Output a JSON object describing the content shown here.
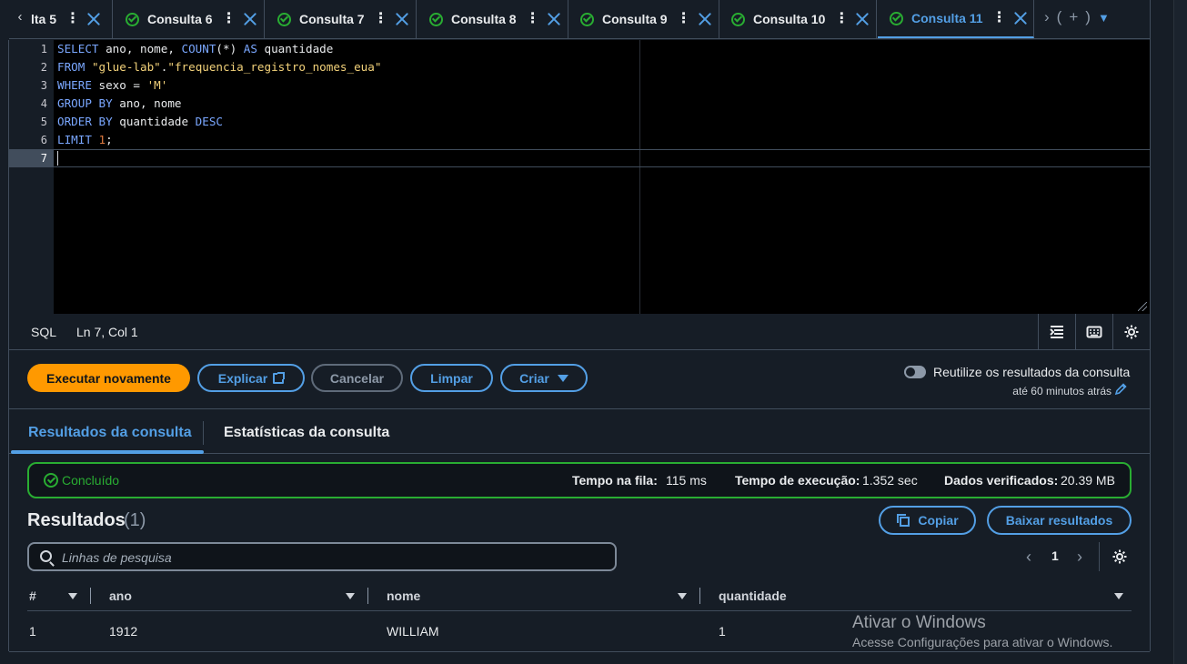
{
  "tabs": [
    {
      "label": "lta 5",
      "active": false
    },
    {
      "label": "Consulta 6",
      "active": false
    },
    {
      "label": "Consulta 7",
      "active": false
    },
    {
      "label": "Consulta 8",
      "active": false
    },
    {
      "label": "Consulta 9",
      "active": false
    },
    {
      "label": "Consulta 10",
      "active": false
    },
    {
      "label": "Consulta 11",
      "active": true
    }
  ],
  "tab_tools": {
    "prev": "›",
    "open_paren": "(",
    "plus": "+",
    "close_paren": ")",
    "dropdown": "▼"
  },
  "editor": {
    "line_numbers": [
      "1",
      "2",
      "3",
      "4",
      "5",
      "6",
      "7"
    ],
    "current_line": "7"
  },
  "statusbar": {
    "language": "SQL",
    "position": "Ln 7, Col 1"
  },
  "actions": {
    "run_again": "Executar novamente",
    "explain": "Explicar",
    "cancel": "Cancelar",
    "clear": "Limpar",
    "create": "Criar",
    "reuse_label": "Reutilize os resultados da consulta",
    "reuse_sub": "até 60 minutos atrás"
  },
  "results_tabs": {
    "results": "Resultados da consulta",
    "stats": "Estatísticas da consulta"
  },
  "status": {
    "text": "Concluído",
    "queue_label": "Tempo na fila:",
    "queue_value": "115 ms",
    "exec_label": "Tempo de execução:",
    "exec_value": "1.352 sec",
    "scanned_label": "Dados verificados:",
    "scanned_value": "20.39 MB",
    "color": "#29ad32"
  },
  "results": {
    "title": "Resultados",
    "count": "(1)",
    "copy": "Copiar",
    "download": "Baixar resultados",
    "search_placeholder": "Linhas de pesquisa",
    "page": "1"
  },
  "table": {
    "columns": [
      "#",
      "ano",
      "nome",
      "quantidade"
    ],
    "rows": [
      {
        "index": "1",
        "ano": "1912",
        "nome": "WILLIAM",
        "quantidade": "1"
      }
    ]
  },
  "watermark": {
    "title": "Ativar o Windows",
    "sub": "Acesse Configurações para ativar o Windows."
  },
  "colors": {
    "accent": "#539fe5",
    "primary": "#ff9900",
    "success": "#29ad32",
    "background": "#161d26"
  }
}
